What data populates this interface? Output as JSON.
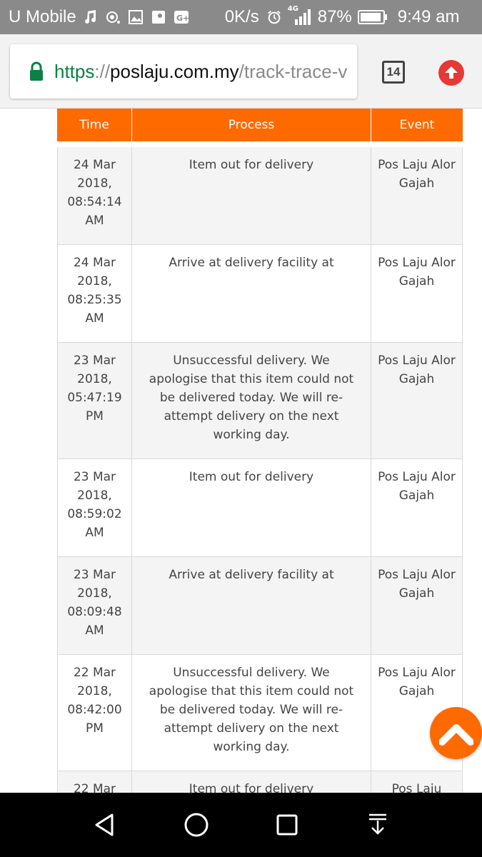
{
  "status_bar": {
    "carrier": "U Mobile",
    "net_speed": "0K/s",
    "network_type": "4G",
    "battery": "87%",
    "time": "9:49 am",
    "icons": [
      "music-icon",
      "hotspot-icon",
      "gallery-icon",
      "maps-icon",
      "google-plus-icon",
      "alarm-icon",
      "signal-icon",
      "battery-icon"
    ]
  },
  "browser": {
    "url_scheme": "https",
    "url_sep": "://",
    "url_host": "poslaju.com.my",
    "url_path": "/track-trace-v",
    "tab_count": "14",
    "accent": "#ff6a00"
  },
  "table": {
    "headers": {
      "time": "Time",
      "process": "Process",
      "event": "Event"
    },
    "rows": [
      {
        "time": "24 Mar 2018, 08:54:14 AM",
        "process": "Item out for delivery",
        "event": "Pos Laju Alor Gajah"
      },
      {
        "time": "24 Mar 2018, 08:25:35 AM",
        "process": "Arrive at delivery facility at",
        "event": "Pos Laju Alor Gajah"
      },
      {
        "time": "23 Mar 2018, 05:47:19 PM",
        "process": "Unsuccessful delivery. We apologise that this item could not be delivered today. We will re-attempt delivery on the next working day.",
        "event": "Pos Laju Alor Gajah"
      },
      {
        "time": "23 Mar 2018, 08:59:02 AM",
        "process": "Item out for delivery",
        "event": "Pos Laju Alor Gajah"
      },
      {
        "time": "23 Mar 2018, 08:09:48 AM",
        "process": "Arrive at delivery facility at",
        "event": "Pos Laju Alor Gajah"
      },
      {
        "time": "22 Mar 2018, 08:42:00 PM",
        "process": "Unsuccessful delivery. We apologise that this item could not be delivered today. We will re-attempt delivery on the next working day.",
        "event": "Pos Laju Alor Gajah"
      },
      {
        "time": "22 Mar",
        "process": "Item out for delivery",
        "event": "Pos Laju"
      }
    ]
  },
  "nav": {
    "icons": [
      "back-icon",
      "home-icon",
      "recents-icon",
      "notification-pull-icon"
    ]
  }
}
